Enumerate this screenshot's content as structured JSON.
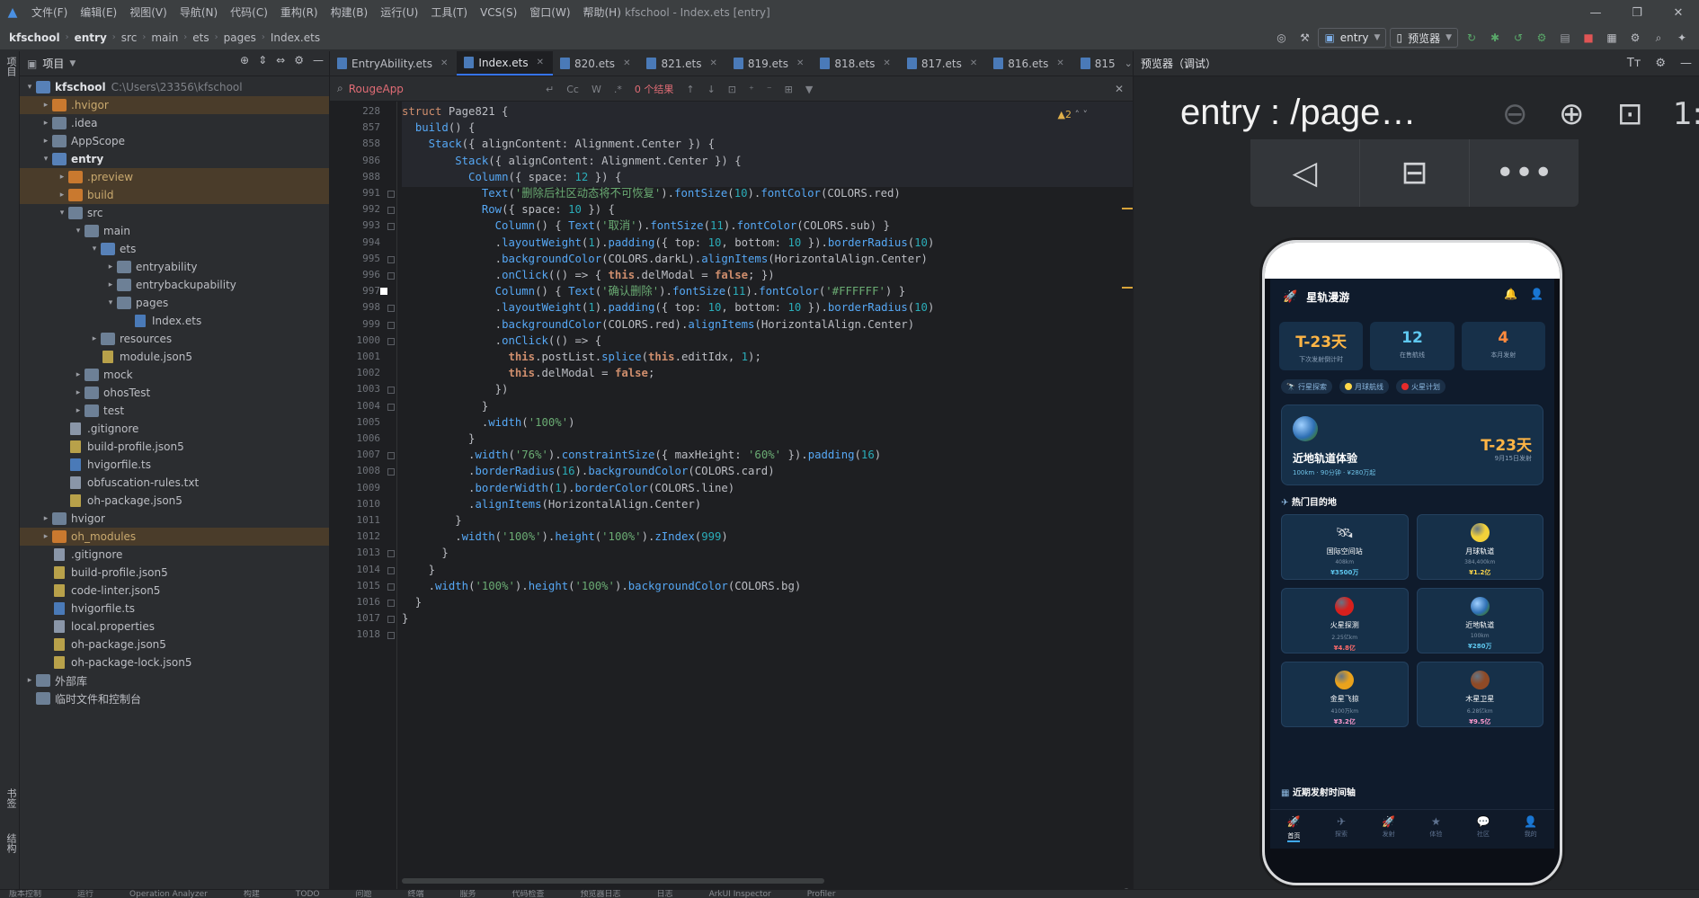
{
  "app": {
    "window_title": "kfschool - Index.ets [entry]",
    "menus": [
      "文件(F)",
      "编辑(E)",
      "视图(V)",
      "导航(N)",
      "代码(C)",
      "重构(R)",
      "构建(B)",
      "运行(U)",
      "工具(T)",
      "VCS(S)",
      "窗口(W)",
      "帮助(H)"
    ]
  },
  "breadcrumb": [
    "kfschool",
    "entry",
    "src",
    "main",
    "ets",
    "pages",
    "Index.ets"
  ],
  "toolbar": {
    "run_config": "entry",
    "device": "预览器"
  },
  "left_stripe": {
    "project": "项目",
    "bookmarks": "书签",
    "structure": "结构"
  },
  "project_panel": {
    "title": "项目",
    "tree": [
      {
        "label": "kfschool",
        "path": "C:\\Users\\23356\\kfschool",
        "depth": 0,
        "arrow": "▾",
        "icon": "folder-blue",
        "bold": true
      },
      {
        "label": ".hvigor",
        "depth": 1,
        "arrow": "▸",
        "icon": "folder-orange",
        "excluded": true
      },
      {
        "label": ".idea",
        "depth": 1,
        "arrow": "▸",
        "icon": "folder"
      },
      {
        "label": "AppScope",
        "depth": 1,
        "arrow": "▸",
        "icon": "folder"
      },
      {
        "label": "entry",
        "depth": 1,
        "arrow": "▾",
        "icon": "folder-blue",
        "bold": true
      },
      {
        "label": ".preview",
        "depth": 2,
        "arrow": "▸",
        "icon": "folder-orange",
        "excluded": true
      },
      {
        "label": "build",
        "depth": 2,
        "arrow": "▸",
        "icon": "folder-orange",
        "excluded": true
      },
      {
        "label": "src",
        "depth": 2,
        "arrow": "▾",
        "icon": "folder"
      },
      {
        "label": "main",
        "depth": 3,
        "arrow": "▾",
        "icon": "folder"
      },
      {
        "label": "ets",
        "depth": 4,
        "arrow": "▾",
        "icon": "folder-blue"
      },
      {
        "label": "entryability",
        "depth": 5,
        "arrow": "▸",
        "icon": "folder"
      },
      {
        "label": "entrybackupability",
        "depth": 5,
        "arrow": "▸",
        "icon": "folder"
      },
      {
        "label": "pages",
        "depth": 5,
        "arrow": "▾",
        "icon": "folder"
      },
      {
        "label": "Index.ets",
        "depth": 6,
        "arrow": "",
        "icon": "file-ts"
      },
      {
        "label": "resources",
        "depth": 4,
        "arrow": "▸",
        "icon": "folder"
      },
      {
        "label": "module.json5",
        "depth": 4,
        "arrow": "",
        "icon": "file-json"
      },
      {
        "label": "mock",
        "depth": 3,
        "arrow": "▸",
        "icon": "folder"
      },
      {
        "label": "ohosTest",
        "depth": 3,
        "arrow": "▸",
        "icon": "folder"
      },
      {
        "label": "test",
        "depth": 3,
        "arrow": "▸",
        "icon": "folder"
      },
      {
        "label": ".gitignore",
        "depth": 2,
        "arrow": "",
        "icon": "file"
      },
      {
        "label": "build-profile.json5",
        "depth": 2,
        "arrow": "",
        "icon": "file-json"
      },
      {
        "label": "hvigorfile.ts",
        "depth": 2,
        "arrow": "",
        "icon": "file-ts"
      },
      {
        "label": "obfuscation-rules.txt",
        "depth": 2,
        "arrow": "",
        "icon": "file"
      },
      {
        "label": "oh-package.json5",
        "depth": 2,
        "arrow": "",
        "icon": "file-json"
      },
      {
        "label": "hvigor",
        "depth": 1,
        "arrow": "▸",
        "icon": "folder"
      },
      {
        "label": "oh_modules",
        "depth": 1,
        "arrow": "▸",
        "icon": "folder-orange",
        "excluded": true
      },
      {
        "label": ".gitignore",
        "depth": 1,
        "arrow": "",
        "icon": "file"
      },
      {
        "label": "build-profile.json5",
        "depth": 1,
        "arrow": "",
        "icon": "file-json"
      },
      {
        "label": "code-linter.json5",
        "depth": 1,
        "arrow": "",
        "icon": "file-json"
      },
      {
        "label": "hvigorfile.ts",
        "depth": 1,
        "arrow": "",
        "icon": "file-ts"
      },
      {
        "label": "local.properties",
        "depth": 1,
        "arrow": "",
        "icon": "file"
      },
      {
        "label": "oh-package.json5",
        "depth": 1,
        "arrow": "",
        "icon": "file-json"
      },
      {
        "label": "oh-package-lock.json5",
        "depth": 1,
        "arrow": "",
        "icon": "file-json"
      },
      {
        "label": "外部库",
        "depth": 0,
        "arrow": "▸",
        "icon": "folder"
      },
      {
        "label": "临时文件和控制台",
        "depth": 0,
        "arrow": "",
        "icon": "folder"
      }
    ]
  },
  "editor": {
    "tabs": [
      {
        "label": "EntryAbility.ets",
        "active": false
      },
      {
        "label": "Index.ets",
        "active": true
      },
      {
        "label": "820.ets",
        "active": false
      },
      {
        "label": "821.ets",
        "active": false
      },
      {
        "label": "819.ets",
        "active": false
      },
      {
        "label": "818.ets",
        "active": false
      },
      {
        "label": "817.ets",
        "active": false
      },
      {
        "label": "816.ets",
        "active": false
      },
      {
        "label": "815",
        "active": false
      }
    ],
    "search_query": "RougeApp",
    "search_opts": [
      "Cc",
      "W",
      ".*"
    ],
    "search_result": "0 个结果",
    "warnings": "▲2",
    "lines": [
      {
        "n": "228",
        "html": "<span class='kw'>struct</span> <span class='fold-name'>Page821</span> {"
      },
      {
        "n": "857",
        "html": "  <span class='fn'>build</span>() {"
      },
      {
        "n": "858",
        "html": "    <span class='fn'>Stack</span>({ alignContent: Alignment.Center }) {"
      },
      {
        "n": "986",
        "html": "        <span class='fn'>Stack</span>({ alignContent: Alignment.Center }) {"
      },
      {
        "n": "988",
        "html": "          <span class='fn'>Column</span>({ space: <span class='num'>12</span> }) {"
      },
      {
        "n": "991",
        "html": "            <span class='fn'>Text</span>(<span class='str'>'删除后社区动态将不可恢复'</span>).<span class='fn'>fontSize</span>(<span class='num'>10</span>).<span class='fn'>fontColor</span>(COLORS.red)"
      },
      {
        "n": "992",
        "html": "            <span class='fn'>Row</span>({ space: <span class='num'>10</span> }) {"
      },
      {
        "n": "993",
        "html": "              <span class='fn'>Column</span>() { <span class='fn'>Text</span>(<span class='str'>'取消'</span>).<span class='fn'>fontSize</span>(<span class='num'>11</span>).<span class='fn'>fontColor</span>(COLORS.sub) }"
      },
      {
        "n": "994",
        "html": "              .<span class='fn'>layoutWeight</span>(<span class='num'>1</span>).<span class='fn'>padding</span>({ top: <span class='num'>10</span>, bottom: <span class='num'>10</span> }).<span class='fn'>borderRadius</span>(<span class='num'>10</span>)"
      },
      {
        "n": "995",
        "html": "              .<span class='fn'>backgroundColor</span>(COLORS.darkL).<span class='fn'>alignItems</span>(HorizontalAlign.Center)"
      },
      {
        "n": "996",
        "html": "              .<span class='fn'>onClick</span>(() => { <span class='this'>this</span>.delModal = <span class='bold-kw'>false</span>; })"
      },
      {
        "n": "997",
        "html": "              <span class='fn'>Column</span>() { <span class='fn'>Text</span>(<span class='str'>'确认删除'</span>).<span class='fn'>fontSize</span>(<span class='num'>11</span>).<span class='fn'>fontColor</span>(<span class='str'>'#FFFFFF'</span>) }"
      },
      {
        "n": "998",
        "html": "              .<span class='fn'>layoutWeight</span>(<span class='num'>1</span>).<span class='fn'>padding</span>({ top: <span class='num'>10</span>, bottom: <span class='num'>10</span> }).<span class='fn'>borderRadius</span>(<span class='num'>10</span>)"
      },
      {
        "n": "999",
        "html": "              .<span class='fn'>backgroundColor</span>(COLORS.red).<span class='fn'>alignItems</span>(HorizontalAlign.Center)"
      },
      {
        "n": "1000",
        "html": "              .<span class='fn'>onClick</span>(() => {"
      },
      {
        "n": "1001",
        "html": "                <span class='this'>this</span>.postList.<span class='fn'>splice</span>(<span class='this'>this</span>.editIdx, <span class='num'>1</span>);"
      },
      {
        "n": "1002",
        "html": "                <span class='this'>this</span>.delModal = <span class='bold-kw'>false</span>;"
      },
      {
        "n": "1003",
        "html": "              })"
      },
      {
        "n": "1004",
        "html": "            }"
      },
      {
        "n": "1005",
        "html": "            .<span class='fn'>width</span>(<span class='str'>'100%'</span>)"
      },
      {
        "n": "1006",
        "html": "          }"
      },
      {
        "n": "1007",
        "html": "          .<span class='fn'>width</span>(<span class='str'>'76%'</span>).<span class='fn'>constraintSize</span>({ maxHeight: <span class='str'>'60%'</span> }).<span class='fn'>padding</span>(<span class='num'>16</span>)"
      },
      {
        "n": "1008",
        "html": "          .<span class='fn'>borderRadius</span>(<span class='num'>16</span>).<span class='fn'>backgroundColor</span>(COLORS.card)"
      },
      {
        "n": "1009",
        "html": "          .<span class='fn'>borderWidth</span>(<span class='num'>1</span>).<span class='fn'>borderColor</span>(COLORS.line)"
      },
      {
        "n": "1010",
        "html": "          .<span class='fn'>alignItems</span>(HorizontalAlign.Center)"
      },
      {
        "n": "1011",
        "html": "        }"
      },
      {
        "n": "1012",
        "html": "        .<span class='fn'>width</span>(<span class='str'>'100%'</span>).<span class='fn'>height</span>(<span class='str'>'100%'</span>).<span class='fn'>zIndex</span>(<span class='num'>999</span>)"
      },
      {
        "n": "1013",
        "html": "      }"
      },
      {
        "n": "1014",
        "html": "    }"
      },
      {
        "n": "1015",
        "html": "    .<span class='fn'>width</span>(<span class='str'>'100%'</span>).<span class='fn'>height</span>(<span class='str'>'100%'</span>).<span class='fn'>backgroundColor</span>(COLORS.bg)"
      },
      {
        "n": "1016",
        "html": "  }"
      },
      {
        "n": "1017",
        "html": "}"
      },
      {
        "n": "1018",
        "html": ""
      }
    ]
  },
  "previewer": {
    "title": "预览器（调试）",
    "page_path": "entry : /page…",
    "app": {
      "title": "星轨漫游",
      "stats": [
        {
          "value": "T-23天",
          "label": "下次发射倒计时",
          "color": "#ffb545"
        },
        {
          "value": "12",
          "label": "在售航线",
          "color": "#5fc8f0"
        },
        {
          "value": "4",
          "label": "本月发射",
          "color": "#ff8a3d"
        }
      ],
      "chips": [
        {
          "label": "行星探索",
          "dot": "none"
        },
        {
          "label": "月球航线",
          "dot": "#ffd84a"
        },
        {
          "label": "火星计划",
          "dot": "#e62b2b"
        }
      ],
      "feature": {
        "title": "近地轨道体验",
        "sub": "100km · 90分钟 · ¥280万起",
        "countdown": "T-23天",
        "date": "9月15日发射"
      },
      "section_hot": "热门目的地",
      "destinations": [
        {
          "name": "国际空间站",
          "dist": "408km",
          "price": "¥3500万",
          "ball": "iss",
          "price_color": "#5fc8f0"
        },
        {
          "name": "月球轨道",
          "dist": "384,400km",
          "price": "¥1.2亿",
          "ball": "#f2d13a",
          "price_color": "#ffd84a"
        },
        {
          "name": "火星探测",
          "dist": "2.25亿km",
          "price": "¥4.8亿",
          "ball": "#d8201d",
          "price_color": "#ff6b6b"
        },
        {
          "name": "近地轨道",
          "dist": "100km",
          "price": "¥280万",
          "ball": "earth",
          "price_color": "#5fc8f0"
        },
        {
          "name": "金星飞掠",
          "dist": "4100万km",
          "price": "¥3.2亿",
          "ball": "#e9a21c",
          "price_color": "#ff9cd0"
        },
        {
          "name": "木星卫星",
          "dist": "6.28亿km",
          "price": "¥9.5亿",
          "ball": "#8f4a26",
          "price_color": "#ff9cd0"
        }
      ],
      "section_launch": "近期发射时间轴",
      "tabbar": [
        "首页",
        "探索",
        "发射",
        "体验",
        "社区",
        "我的"
      ],
      "tab_icons": [
        "🚀",
        "✈",
        "🚀",
        "★",
        "💬",
        "👤"
      ]
    }
  },
  "statusbar": [
    "版本控制",
    "运行",
    "Operation Analyzer",
    "构建",
    "TODO",
    "问题",
    "终端",
    "服务",
    "代码检查",
    "预览器日志",
    "日志",
    "ArkUI Inspector",
    "Profiler"
  ]
}
